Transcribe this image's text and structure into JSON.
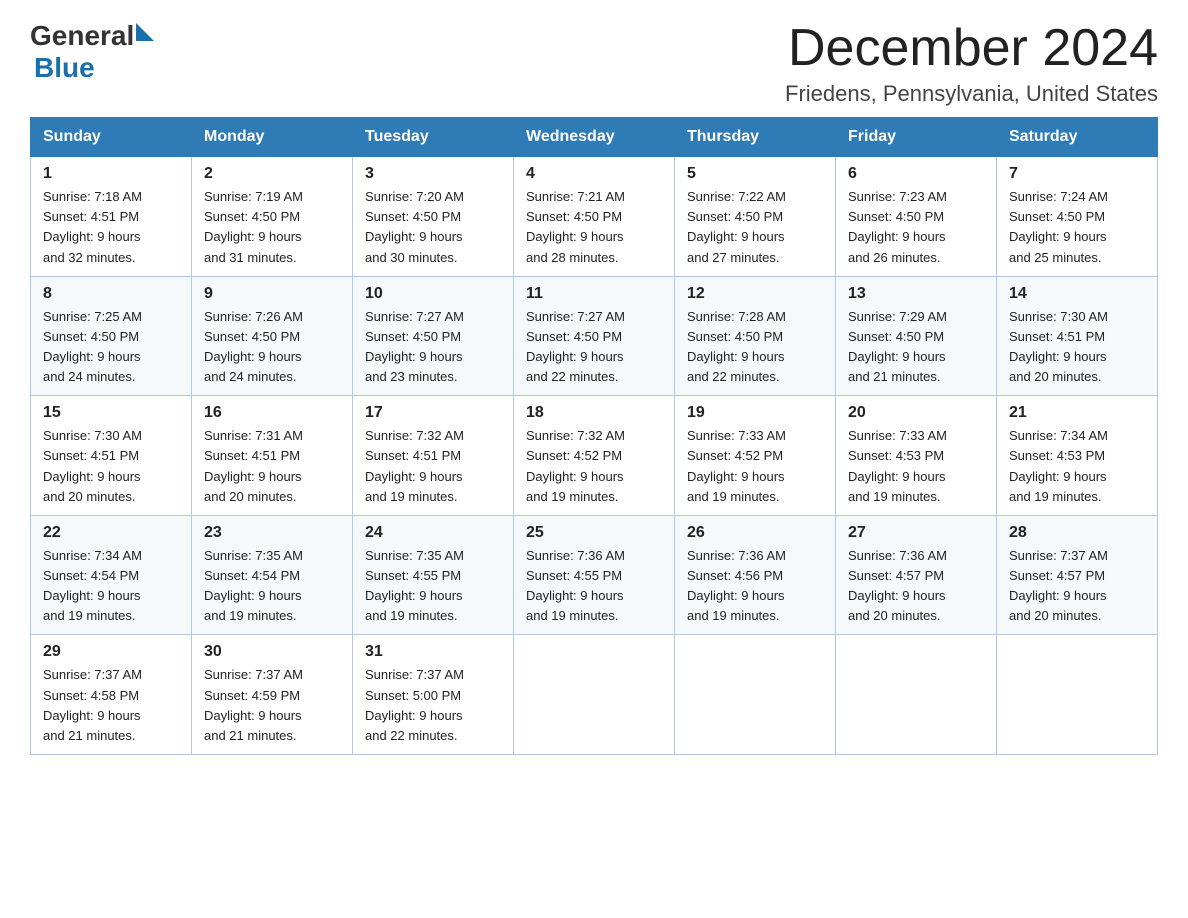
{
  "header": {
    "logo": {
      "general": "General",
      "blue": "Blue"
    },
    "month_title": "December 2024",
    "location": "Friedens, Pennsylvania, United States"
  },
  "weekdays": [
    "Sunday",
    "Monday",
    "Tuesday",
    "Wednesday",
    "Thursday",
    "Friday",
    "Saturday"
  ],
  "weeks": [
    [
      {
        "day": "1",
        "sunrise": "7:18 AM",
        "sunset": "4:51 PM",
        "daylight": "9 hours and 32 minutes."
      },
      {
        "day": "2",
        "sunrise": "7:19 AM",
        "sunset": "4:50 PM",
        "daylight": "9 hours and 31 minutes."
      },
      {
        "day": "3",
        "sunrise": "7:20 AM",
        "sunset": "4:50 PM",
        "daylight": "9 hours and 30 minutes."
      },
      {
        "day": "4",
        "sunrise": "7:21 AM",
        "sunset": "4:50 PM",
        "daylight": "9 hours and 28 minutes."
      },
      {
        "day": "5",
        "sunrise": "7:22 AM",
        "sunset": "4:50 PM",
        "daylight": "9 hours and 27 minutes."
      },
      {
        "day": "6",
        "sunrise": "7:23 AM",
        "sunset": "4:50 PM",
        "daylight": "9 hours and 26 minutes."
      },
      {
        "day": "7",
        "sunrise": "7:24 AM",
        "sunset": "4:50 PM",
        "daylight": "9 hours and 25 minutes."
      }
    ],
    [
      {
        "day": "8",
        "sunrise": "7:25 AM",
        "sunset": "4:50 PM",
        "daylight": "9 hours and 24 minutes."
      },
      {
        "day": "9",
        "sunrise": "7:26 AM",
        "sunset": "4:50 PM",
        "daylight": "9 hours and 24 minutes."
      },
      {
        "day": "10",
        "sunrise": "7:27 AM",
        "sunset": "4:50 PM",
        "daylight": "9 hours and 23 minutes."
      },
      {
        "day": "11",
        "sunrise": "7:27 AM",
        "sunset": "4:50 PM",
        "daylight": "9 hours and 22 minutes."
      },
      {
        "day": "12",
        "sunrise": "7:28 AM",
        "sunset": "4:50 PM",
        "daylight": "9 hours and 22 minutes."
      },
      {
        "day": "13",
        "sunrise": "7:29 AM",
        "sunset": "4:50 PM",
        "daylight": "9 hours and 21 minutes."
      },
      {
        "day": "14",
        "sunrise": "7:30 AM",
        "sunset": "4:51 PM",
        "daylight": "9 hours and 20 minutes."
      }
    ],
    [
      {
        "day": "15",
        "sunrise": "7:30 AM",
        "sunset": "4:51 PM",
        "daylight": "9 hours and 20 minutes."
      },
      {
        "day": "16",
        "sunrise": "7:31 AM",
        "sunset": "4:51 PM",
        "daylight": "9 hours and 20 minutes."
      },
      {
        "day": "17",
        "sunrise": "7:32 AM",
        "sunset": "4:51 PM",
        "daylight": "9 hours and 19 minutes."
      },
      {
        "day": "18",
        "sunrise": "7:32 AM",
        "sunset": "4:52 PM",
        "daylight": "9 hours and 19 minutes."
      },
      {
        "day": "19",
        "sunrise": "7:33 AM",
        "sunset": "4:52 PM",
        "daylight": "9 hours and 19 minutes."
      },
      {
        "day": "20",
        "sunrise": "7:33 AM",
        "sunset": "4:53 PM",
        "daylight": "9 hours and 19 minutes."
      },
      {
        "day": "21",
        "sunrise": "7:34 AM",
        "sunset": "4:53 PM",
        "daylight": "9 hours and 19 minutes."
      }
    ],
    [
      {
        "day": "22",
        "sunrise": "7:34 AM",
        "sunset": "4:54 PM",
        "daylight": "9 hours and 19 minutes."
      },
      {
        "day": "23",
        "sunrise": "7:35 AM",
        "sunset": "4:54 PM",
        "daylight": "9 hours and 19 minutes."
      },
      {
        "day": "24",
        "sunrise": "7:35 AM",
        "sunset": "4:55 PM",
        "daylight": "9 hours and 19 minutes."
      },
      {
        "day": "25",
        "sunrise": "7:36 AM",
        "sunset": "4:55 PM",
        "daylight": "9 hours and 19 minutes."
      },
      {
        "day": "26",
        "sunrise": "7:36 AM",
        "sunset": "4:56 PM",
        "daylight": "9 hours and 19 minutes."
      },
      {
        "day": "27",
        "sunrise": "7:36 AM",
        "sunset": "4:57 PM",
        "daylight": "9 hours and 20 minutes."
      },
      {
        "day": "28",
        "sunrise": "7:37 AM",
        "sunset": "4:57 PM",
        "daylight": "9 hours and 20 minutes."
      }
    ],
    [
      {
        "day": "29",
        "sunrise": "7:37 AM",
        "sunset": "4:58 PM",
        "daylight": "9 hours and 21 minutes."
      },
      {
        "day": "30",
        "sunrise": "7:37 AM",
        "sunset": "4:59 PM",
        "daylight": "9 hours and 21 minutes."
      },
      {
        "day": "31",
        "sunrise": "7:37 AM",
        "sunset": "5:00 PM",
        "daylight": "9 hours and 22 minutes."
      },
      null,
      null,
      null,
      null
    ]
  ],
  "labels": {
    "sunrise": "Sunrise:",
    "sunset": "Sunset:",
    "daylight": "Daylight:"
  }
}
